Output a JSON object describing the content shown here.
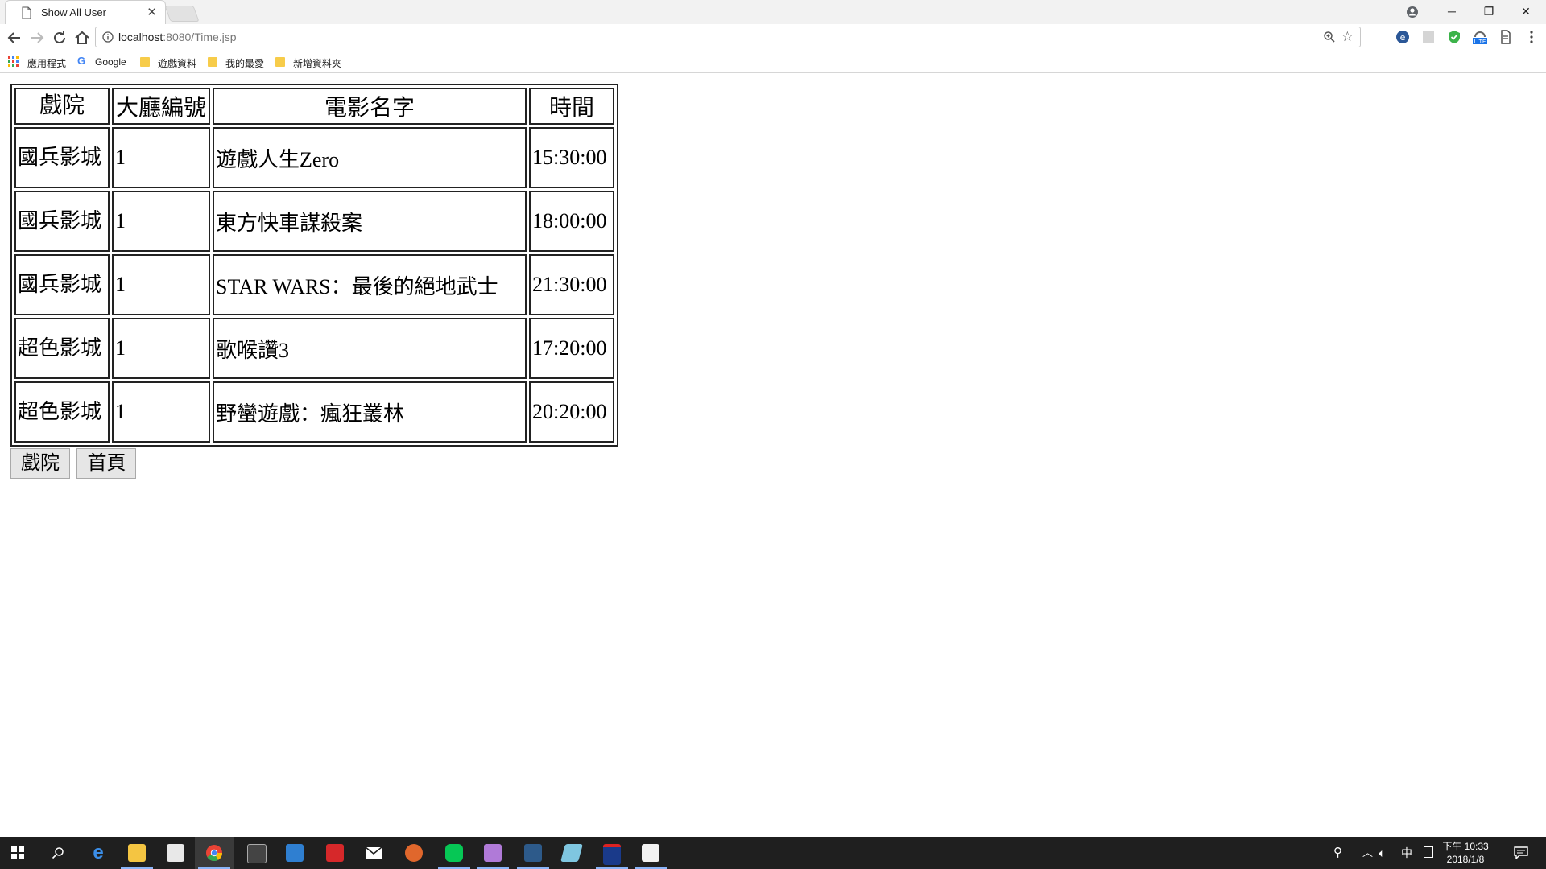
{
  "browser": {
    "tab_title": "Show All User",
    "url_host": "localhost",
    "url_path": ":8080/Time.jsp",
    "bookmarks": [
      {
        "label": "應用程式",
        "icon": "apps-grid-icon"
      },
      {
        "label": "Google",
        "icon": "google-icon"
      },
      {
        "label": "遊戲資料",
        "icon": "folder-icon"
      },
      {
        "label": "我的最愛",
        "icon": "folder-icon"
      },
      {
        "label": "新增資料夾",
        "icon": "folder-icon"
      }
    ]
  },
  "table": {
    "headers": [
      "戲院",
      "大廳編號",
      "電影名字",
      "時間"
    ],
    "rows": [
      {
        "theater": "國兵影城",
        "hall": "1",
        "movie": "遊戲人生Zero",
        "time": "15:30:00"
      },
      {
        "theater": "國兵影城",
        "hall": "1",
        "movie": "東方快車謀殺案",
        "time": "18:00:00"
      },
      {
        "theater": "國兵影城",
        "hall": "1",
        "movie": "STAR WARS：最後的絕地武士",
        "time": "21:30:00"
      },
      {
        "theater": "超色影城",
        "hall": "1",
        "movie": "歌喉讚3",
        "time": "17:20:00"
      },
      {
        "theater": "超色影城",
        "hall": "1",
        "movie": "野蠻遊戲：瘋狂叢林",
        "time": "20:20:00"
      }
    ]
  },
  "buttons": {
    "theater_label": "戲院",
    "home_label": "首頁"
  },
  "taskbar": {
    "clock_time": "下午 10:33",
    "clock_date": "2018/1/8",
    "ime": "中",
    "accent_color": "#8ab4f8"
  }
}
